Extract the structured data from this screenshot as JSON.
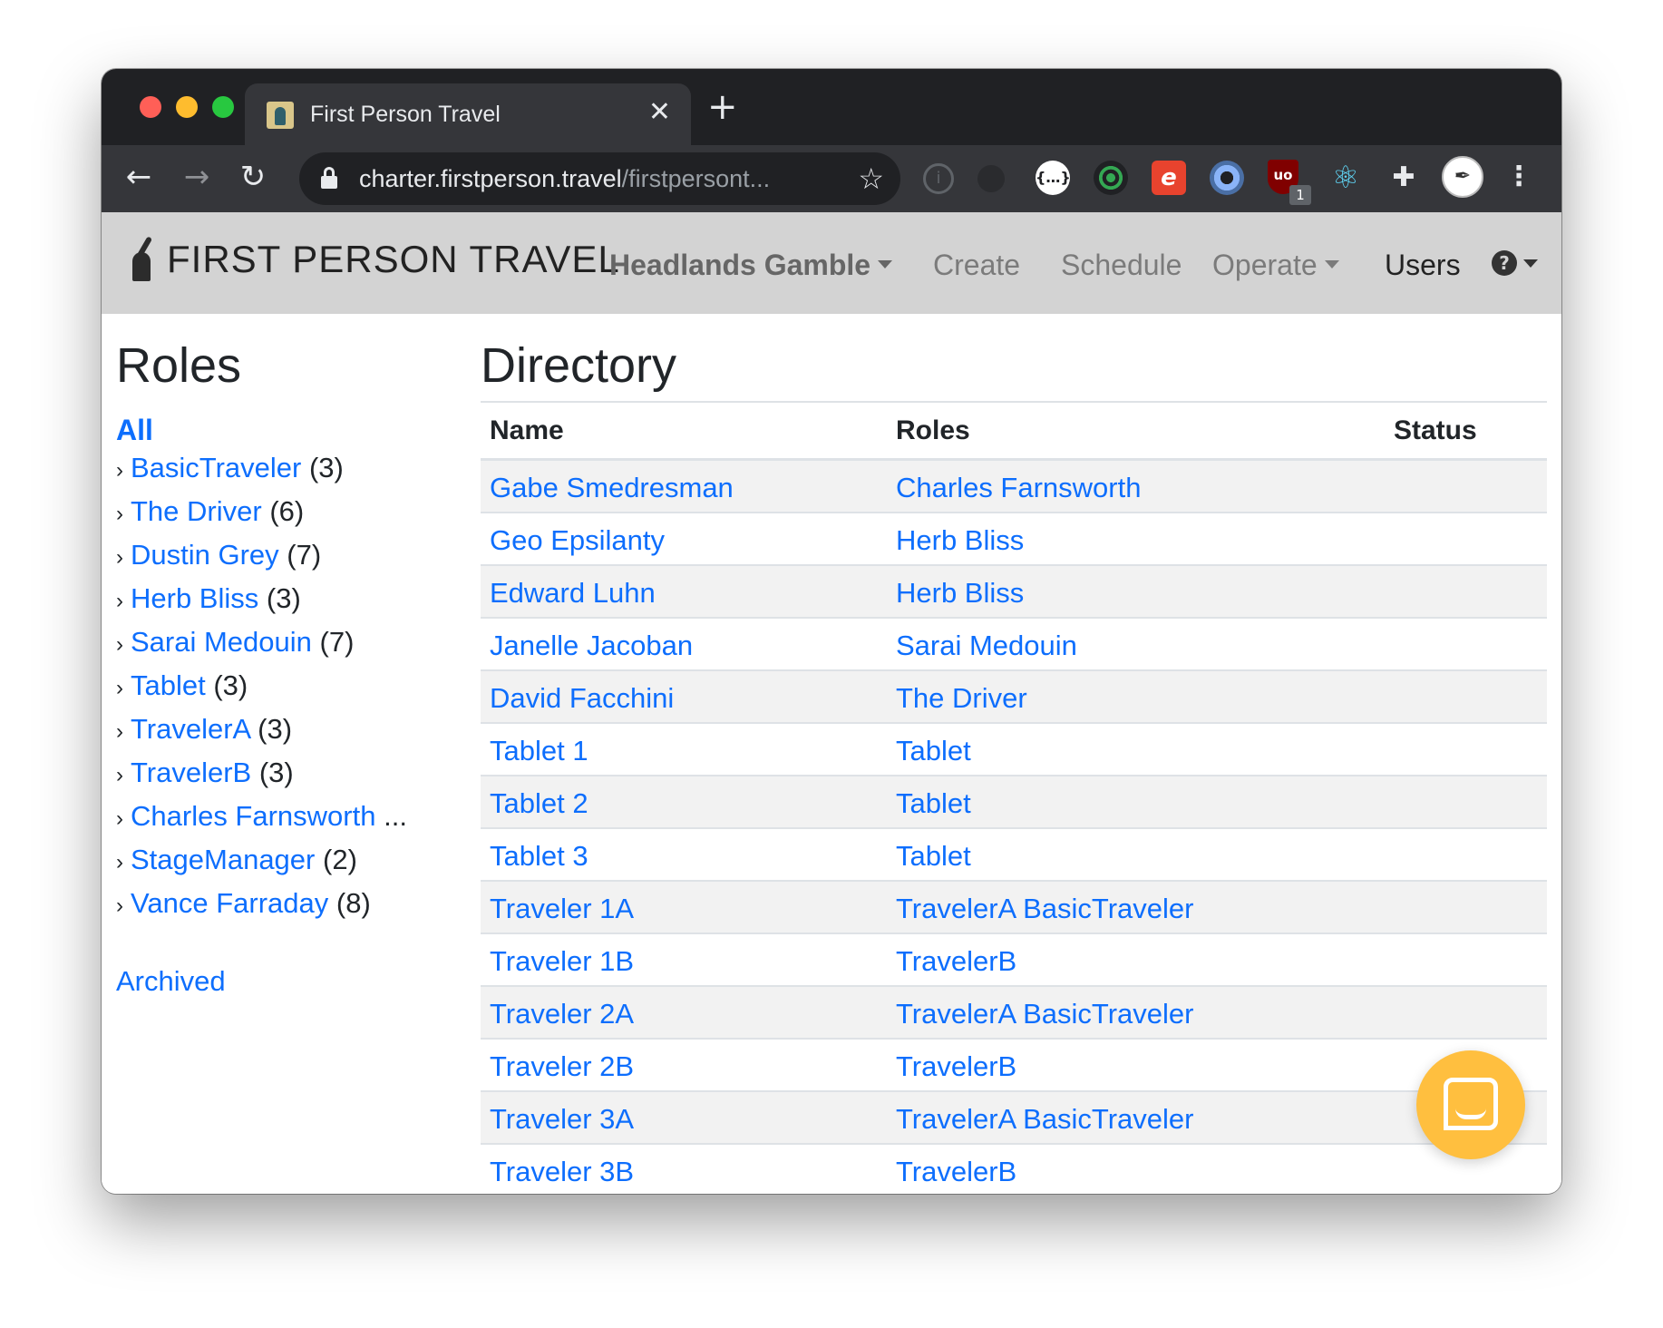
{
  "browser": {
    "tab_title": "First Person Travel",
    "tab_close": "✕",
    "new_tab": "+",
    "url_host": "charter.firstperson.travel",
    "url_path": "/firstpersont...",
    "extension_badge": "1"
  },
  "navbar": {
    "brand": "FIRST PERSON TRAVEL",
    "project": "Headlands Gamble",
    "links": [
      "Create",
      "Schedule",
      "Operate",
      "Users"
    ],
    "help": "?"
  },
  "sidebar": {
    "title": "Roles",
    "all": "All",
    "roles": [
      {
        "label": "BasicTraveler",
        "count": "(3)"
      },
      {
        "label": "The Driver",
        "count": "(6)"
      },
      {
        "label": "Dustin Grey",
        "count": "(7)"
      },
      {
        "label": "Herb Bliss",
        "count": "(3)"
      },
      {
        "label": "Sarai Medouin",
        "count": "(7)"
      },
      {
        "label": "Tablet",
        "count": "(3)"
      },
      {
        "label": "TravelerA",
        "count": "(3)"
      },
      {
        "label": "TravelerB",
        "count": "(3)"
      },
      {
        "label": "Charles Farnsworth",
        "count": "..."
      },
      {
        "label": "StageManager",
        "count": "(2)"
      },
      {
        "label": "Vance Farraday",
        "count": "(8)"
      }
    ],
    "archived": "Archived"
  },
  "main": {
    "title": "Directory",
    "columns": [
      "Name",
      "Roles",
      "Status"
    ],
    "rows": [
      {
        "name": "Gabe Smedresman",
        "roles": "Charles Farnsworth"
      },
      {
        "name": "Geo Epsilanty",
        "roles": "Herb Bliss"
      },
      {
        "name": "Edward Luhn",
        "roles": "Herb Bliss"
      },
      {
        "name": "Janelle Jacoban",
        "roles": "Sarai Medouin"
      },
      {
        "name": "David Facchini",
        "roles": "The Driver"
      },
      {
        "name": "Tablet 1",
        "roles": "Tablet"
      },
      {
        "name": "Tablet 2",
        "roles": "Tablet"
      },
      {
        "name": "Tablet 3",
        "roles": "Tablet"
      },
      {
        "name": "Traveler 1A",
        "roles": "TravelerA BasicTraveler"
      },
      {
        "name": "Traveler 1B",
        "roles": "TravelerB"
      },
      {
        "name": "Traveler 2A",
        "roles": "TravelerA BasicTraveler"
      },
      {
        "name": "Traveler 2B",
        "roles": "TravelerB"
      },
      {
        "name": "Traveler 3A",
        "roles": "TravelerA BasicTraveler"
      },
      {
        "name": "Traveler 3B",
        "roles": "TravelerB"
      }
    ]
  },
  "colors": {
    "link": "#0d6efd",
    "navbar_bg": "#d3d3d3",
    "chat_bubble": "#ffbf3f"
  }
}
